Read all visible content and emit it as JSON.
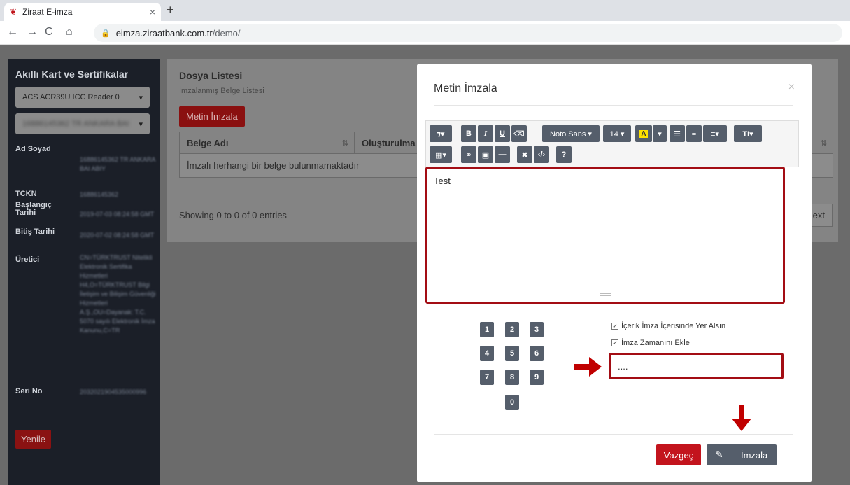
{
  "browser": {
    "tab_title": "Ziraat E-imza",
    "tab_close": "×",
    "new_tab": "+",
    "url_host": "eimza.ziraatbank.com.tr",
    "url_path": "/demo/",
    "back": "←",
    "forward": "→",
    "reload": "C",
    "home": "⌂"
  },
  "sidebar": {
    "title": "Akıllı Kart ve Sertifikalar",
    "reader_select": "ACS ACR39U ICC Reader 0",
    "cert_select": "16886145362 TR ANKARA BAI",
    "labels": {
      "name": "Ad Soyad",
      "tckn": "TCKN",
      "start": "Başlangıç Tarihi",
      "end": "Bitiş Tarihi",
      "issuer": "Üretici",
      "serial": "Seri No"
    },
    "values": {
      "name": "16886145362 TR ANKARA BAI ABIY",
      "tckn": "16886145362",
      "start": "2019-07-03 08:24:58 GMT",
      "end": "2020-07-02 08:24:58 GMT",
      "issuer": "CN=TÜRKTRUST Nitelikli Elektronik Sertifika Hizmetleri H4,O=TÜRKTRUST Bilgi İletişim ve Bilişim Güvenliği Hizmetleri A.Ş.,OU=Dayanak: T.C. 5070 sayılı Elektronik İmza Kanunu,C=TR",
      "serial": "2032021904535000996"
    },
    "renew_label": "Yenile"
  },
  "main": {
    "title": "Dosya Listesi",
    "subtitle": "İmzalanmış Belge Listesi",
    "sign_text_button": "Metin İmzala",
    "columns": [
      "Belge Adı",
      "Oluşturulma"
    ],
    "empty_row": "İmzalı herhangi bir belge bulunmamaktadır",
    "showing": "Showing 0 to 0 of 0 entries",
    "next": "Next"
  },
  "modal": {
    "title": "Metin İmzala",
    "close": "×",
    "toolbar": {
      "style": "⁊▾",
      "bold": "B",
      "italic": "I",
      "underline": "U",
      "eraser": "⌫",
      "font": "Noto Sans ▾",
      "size": "14 ▾",
      "color": "A",
      "color_caret": "▾",
      "ul": "☰",
      "ol": "≡",
      "align": "≡▾",
      "height": "TI▾",
      "table": "▦▾",
      "link": "⚭",
      "image": "▣",
      "hr": "—",
      "fullscreen": "✖",
      "code": "‹/›",
      "help": "?"
    },
    "editor_text": "Test",
    "keypad": [
      "1",
      "2",
      "3",
      "4",
      "5",
      "6",
      "7",
      "8",
      "9",
      "0"
    ],
    "check_content": "İçerik İmza İçerisinde Yer Alsın",
    "check_time": "İmza Zamanını Ekle",
    "pin_value": "....",
    "cancel_label": "Vazgeç",
    "sign_label": "İmzala",
    "sign_icon": "✎"
  },
  "annotations": {
    "arrow_color": "#c00000"
  }
}
